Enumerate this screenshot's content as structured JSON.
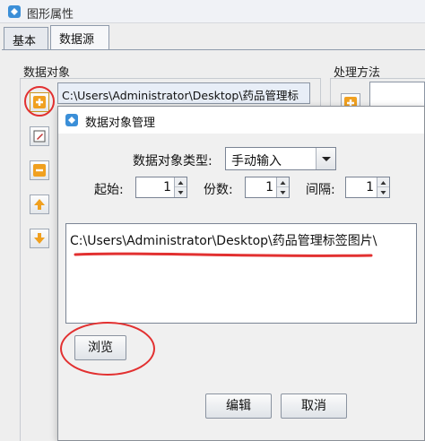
{
  "window": {
    "title": "图形属性"
  },
  "tabs": [
    {
      "label": "基本",
      "active": false
    },
    {
      "label": "数据源",
      "active": true
    }
  ],
  "data_object_group": {
    "label": "数据对象",
    "path_value": "C:\\Users\\Administrator\\Desktop\\药品管理标"
  },
  "processing_group": {
    "label": "处理方法"
  },
  "side_buttons": [
    "add-icon",
    "edit-icon",
    "remove-icon",
    "move-up-icon",
    "move-down-icon"
  ],
  "dialog": {
    "title": "数据对象管理",
    "type_label": "数据对象类型:",
    "type_value": "手动输入",
    "start_label": "起始:",
    "start_value": "1",
    "digits_label": "份数:",
    "digits_value": "1",
    "interval_label": "间隔:",
    "interval_value": "1",
    "content_text": "C:\\Users\\Administrator\\Desktop\\药品管理标签图片\\",
    "browse_label": "浏览",
    "edit_label": "编辑",
    "cancel_label": "取消"
  },
  "colors": {
    "annotation_red": "#e23030",
    "plus_icon_orange": "#f0a020",
    "selected_row_bg": "#e8eef7"
  }
}
